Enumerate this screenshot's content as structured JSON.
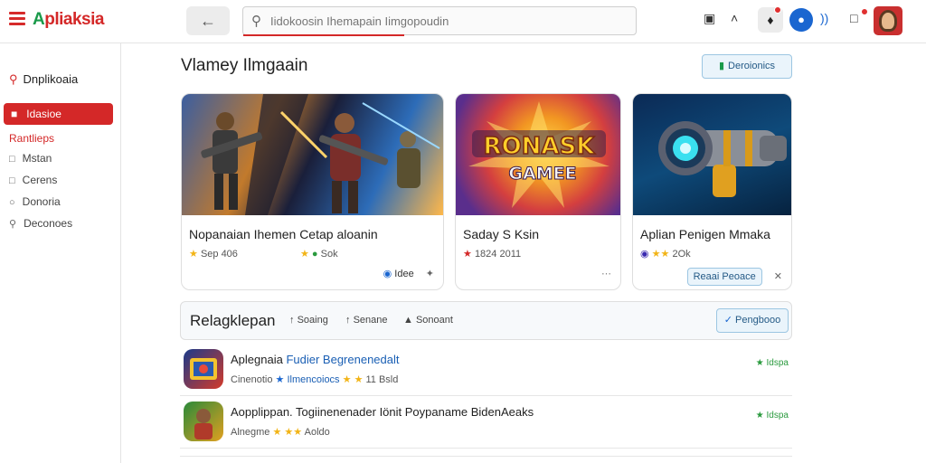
{
  "header": {
    "logo_lead": "A",
    "logo_rest": "pliaksia",
    "search_placeholder": "Iidokoosin Ihemapain Iimgopoudin"
  },
  "sidebar": {
    "heading": "Dnplikoaia",
    "active_item": "Idasioe",
    "sub_label": "Rantlieps",
    "items": [
      "Mstan",
      "Cerens",
      "Donoria",
      "Deconoes"
    ]
  },
  "main": {
    "title": "Vlamey Ilmgaain",
    "top_button": "Deroionics"
  },
  "cards": [
    {
      "title": "Nopanaian Ihemen Cetap aloanin",
      "meta_a": "Sep 406",
      "meta_b": "Sok",
      "footer": "Idee",
      "rating": 5
    },
    {
      "title": "Saday S Ksin",
      "meta_a": "1824 2011",
      "meta_b": "",
      "footer": "",
      "rating": 4
    },
    {
      "title": "Aplian Penigen Mmaka",
      "meta_a": "",
      "meta_b": "2Ok",
      "footer": "Reaai Peoace",
      "rating": 4
    }
  ],
  "card2_art_text": {
    "line1": "RONASK",
    "line2": "GAMEE"
  },
  "filters": {
    "title": "Relagklepan",
    "options": [
      "Soaing",
      "Senane",
      "Sonoant"
    ],
    "button": "Pengbooo"
  },
  "apps": [
    {
      "name": "Aplegnaia",
      "highlight": "Fudier Begrenenedalt",
      "meta_a": "Cinenotio",
      "meta_b": "Ilmencoiocs",
      "meta_c": "11 Bsld",
      "side": "Idspa"
    },
    {
      "name": "Aopplippan. Togiinenenader Iönit Poypaname BidenAeaks",
      "highlight": "",
      "meta_a": "Alnegme",
      "meta_b": "Aoldo",
      "meta_c": "",
      "side": "Idspa"
    }
  ],
  "colors": {
    "accent_red": "#d42828",
    "link_blue": "#1a5fb4",
    "star_yellow": "#f2b416",
    "green": "#2a9a3e"
  },
  "icons": [
    "hamburger-icon",
    "arrow-left-icon",
    "search-icon",
    "camera-icon",
    "chevron-up-icon",
    "bell-icon",
    "audio-icon",
    "bookmark-icon",
    "home-icon",
    "play-icon",
    "box-icon",
    "search-small-icon",
    "share-icon",
    "close-icon",
    "star-icon"
  ]
}
